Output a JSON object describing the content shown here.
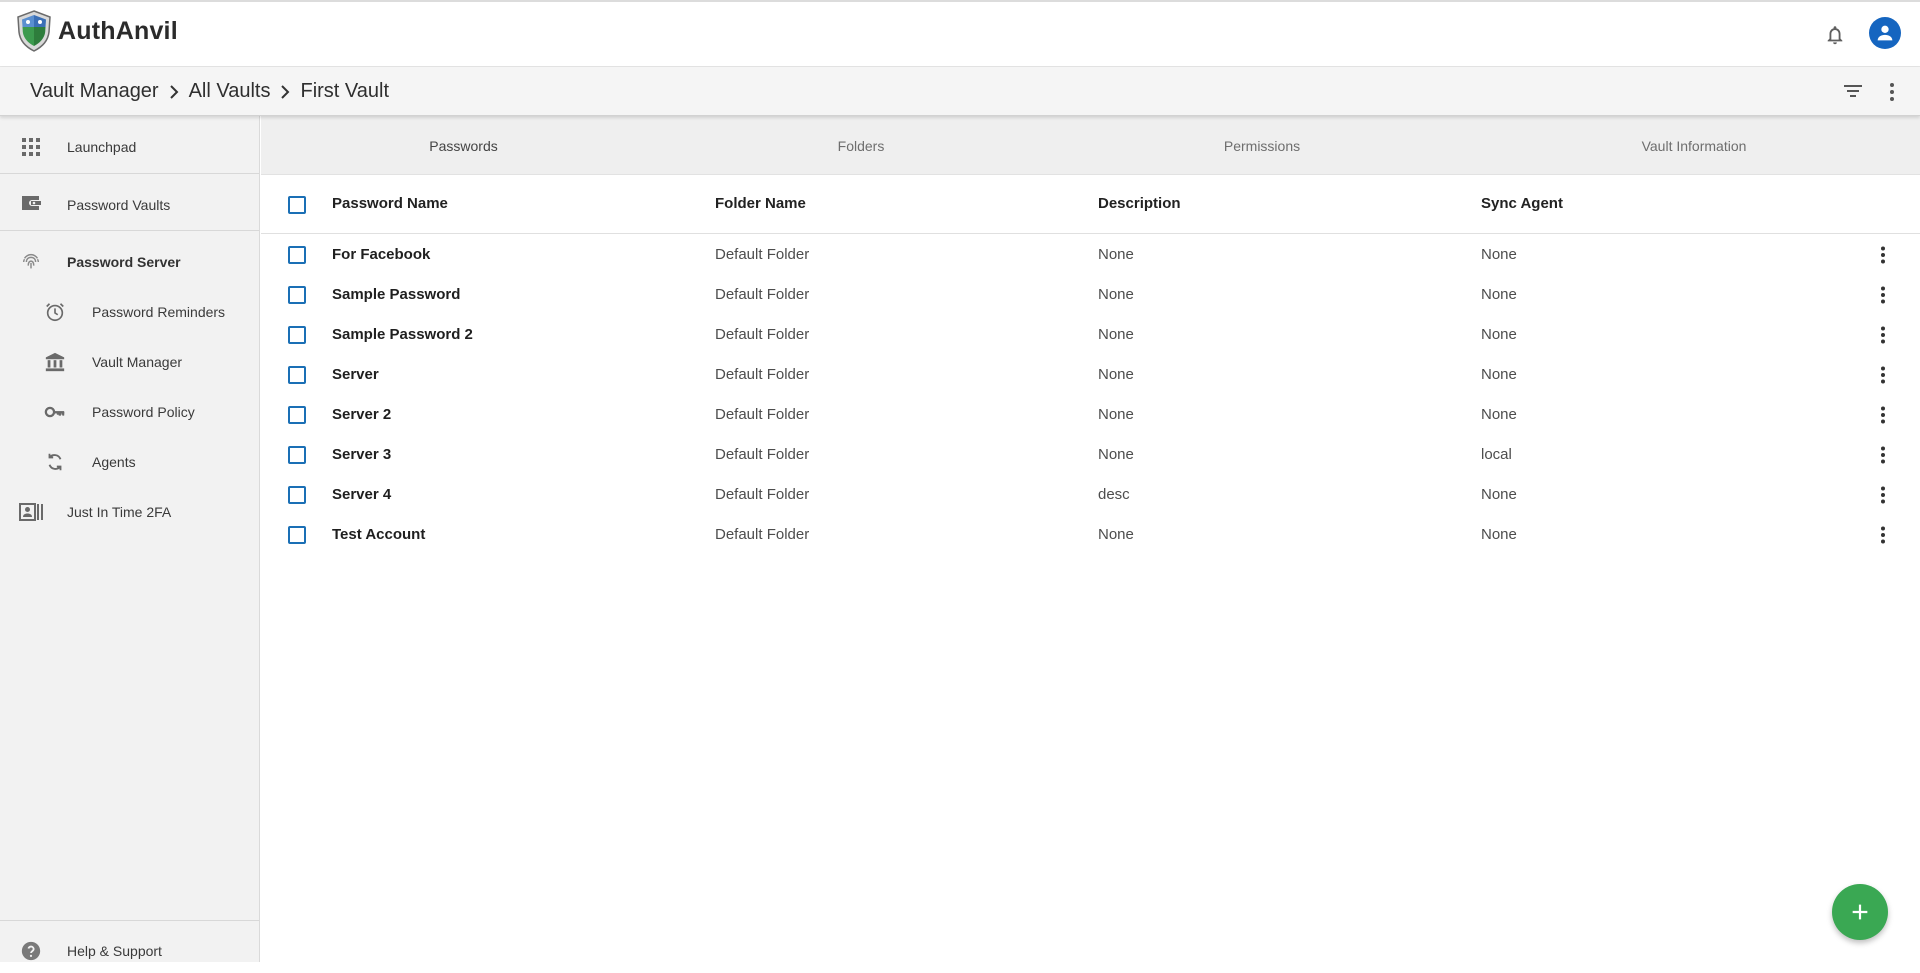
{
  "app": {
    "name": "AuthAnvil"
  },
  "header": {
    "bell_icon": "bell-icon",
    "avatar_icon": "user-avatar-icon"
  },
  "breadcrumb": [
    "Vault Manager",
    "All Vaults",
    "First Vault"
  ],
  "sidebar": {
    "items": [
      {
        "label": "Launchpad",
        "icon": "grid-icon"
      },
      {
        "label": "Password Vaults",
        "icon": "wallet-icon"
      },
      {
        "label": "Password Server",
        "icon": "fingerprint-icon"
      },
      {
        "label": "Password Reminders",
        "icon": "alarm-icon"
      },
      {
        "label": "Vault Manager",
        "icon": "bank-icon"
      },
      {
        "label": "Password Policy",
        "icon": "key-icon"
      },
      {
        "label": "Agents",
        "icon": "sync-icon"
      },
      {
        "label": "Just In Time 2FA",
        "icon": "id-card-icon"
      }
    ],
    "help_label": "Help & Support"
  },
  "tabs": [
    "Passwords",
    "Folders",
    "Permissions",
    "Vault Information"
  ],
  "table": {
    "columns": [
      "Password Name",
      "Folder Name",
      "Description",
      "Sync Agent"
    ],
    "rows": [
      {
        "name": "For Facebook",
        "folder": "Default Folder",
        "description": "None",
        "sync_agent": "None"
      },
      {
        "name": "Sample Password",
        "folder": "Default Folder",
        "description": "None",
        "sync_agent": "None"
      },
      {
        "name": "Sample Password 2",
        "folder": "Default Folder",
        "description": "None",
        "sync_agent": "None"
      },
      {
        "name": "Server",
        "folder": "Default Folder",
        "description": "None",
        "sync_agent": "None"
      },
      {
        "name": "Server 2",
        "folder": "Default Folder",
        "description": "None",
        "sync_agent": "None"
      },
      {
        "name": "Server 3",
        "folder": "Default Folder",
        "description": "None",
        "sync_agent": "local"
      },
      {
        "name": "Server 4",
        "folder": "Default Folder",
        "description": "desc",
        "sync_agent": "None"
      },
      {
        "name": "Test Account",
        "folder": "Default Folder",
        "description": "None",
        "sync_agent": "None"
      }
    ]
  },
  "colors": {
    "accent_blue": "#1a6fb5",
    "fab_green": "#3aa853",
    "avatar_blue": "#1565c0"
  }
}
